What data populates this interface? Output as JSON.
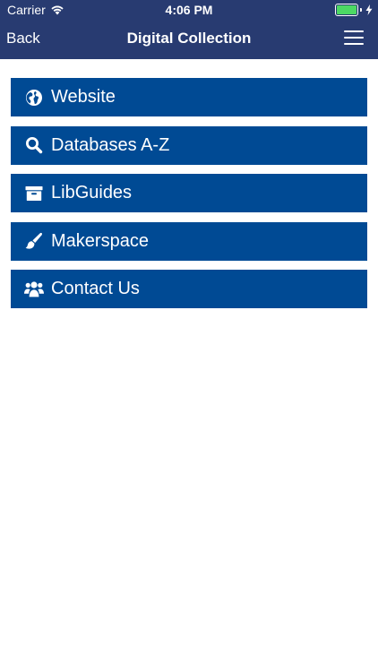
{
  "status_bar": {
    "carrier": "Carrier",
    "time": "4:06 PM",
    "battery_level": 1.0,
    "battery_color": "#4cd964"
  },
  "nav": {
    "back_label": "Back",
    "title": "Digital Collection",
    "menu_icon": "hamburger-icon"
  },
  "colors": {
    "header_bg": "#283b71",
    "button_bg": "#004a94",
    "text": "#ffffff",
    "page_bg": "#ffffff"
  },
  "menu": {
    "items": [
      {
        "label": "Website",
        "icon": "globe-icon"
      },
      {
        "label": "Databases A-Z",
        "icon": "search-icon"
      },
      {
        "label": "LibGuides",
        "icon": "archive-icon"
      },
      {
        "label": "Makerspace",
        "icon": "paintbrush-icon"
      },
      {
        "label": "Contact Us",
        "icon": "users-icon"
      }
    ]
  }
}
